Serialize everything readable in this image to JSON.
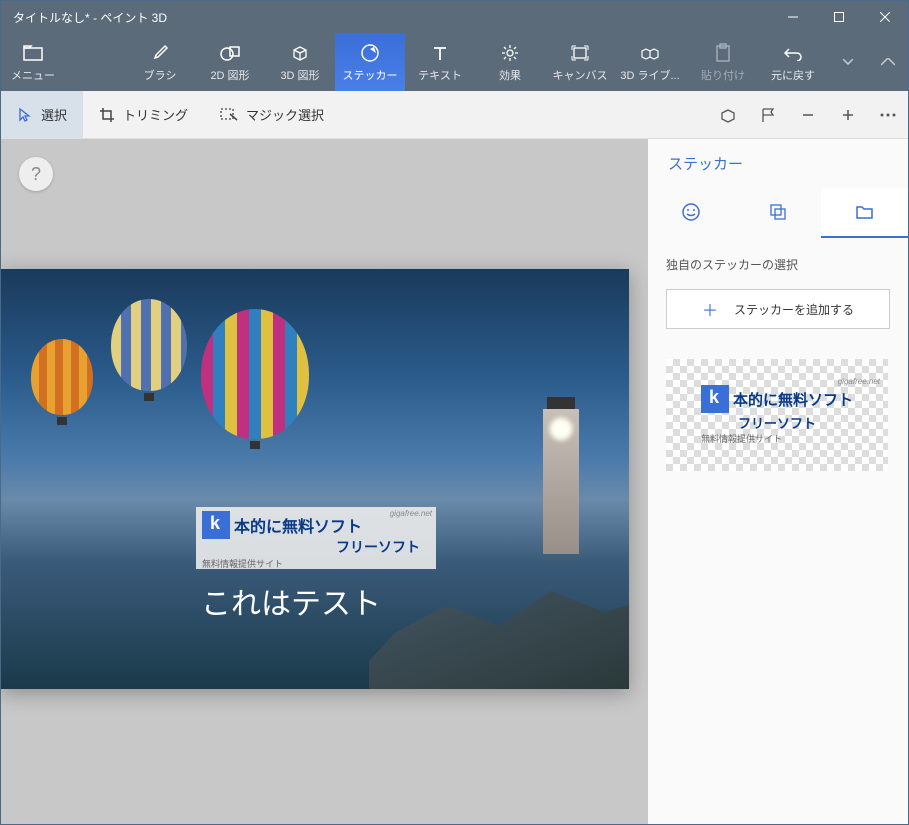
{
  "window": {
    "title": "タイトルなし* - ペイント 3D"
  },
  "ribbon": {
    "menu": "メニュー",
    "brush": "ブラシ",
    "shapes2d": "2D 図形",
    "shapes3d": "3D 図形",
    "sticker": "ステッカー",
    "text": "テキスト",
    "effects": "効果",
    "canvas": "キャンバス",
    "lib3d": "3D ライブ...",
    "paste": "貼り付け",
    "undo": "元に戻す"
  },
  "toolbar": {
    "select": "選択",
    "crop": "トリミング",
    "magic": "マジック選択"
  },
  "side": {
    "title": "ステッカー",
    "section_label": "独自のステッカーの選択",
    "add_button": "ステッカーを追加する"
  },
  "sticker_content": {
    "line1": "本的に無料ソフト",
    "line2": "フリーソフト",
    "line3": "無料情報提供サイト",
    "watermark": "gigafree.net"
  },
  "canvas_text": "これはテスト"
}
